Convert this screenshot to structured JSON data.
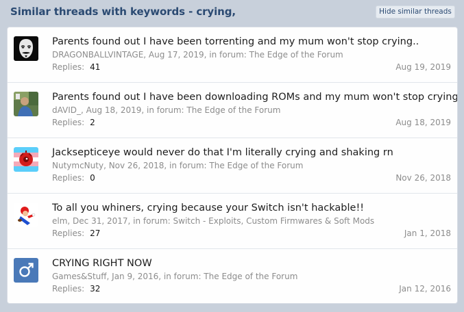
{
  "header": {
    "title": "Similar threads with keywords - crying,",
    "hide_button": "Hide similar threads"
  },
  "replies_label": "Replies:",
  "threads": [
    {
      "title": "Parents found out I have been torrenting and my mum won't stop crying..",
      "meta": "DRAGONBALLVINTAGE, Aug 17, 2019, in forum: The Edge of the Forum",
      "replies": "41",
      "last_date": "Aug 19, 2019",
      "avatar_icon": "anonymous-mask-avatar"
    },
    {
      "title": "Parents found out I have been downloading ROMs and my mum won't stop crying..",
      "meta": "dAVID_, Aug 18, 2019, in forum: The Edge of the Forum",
      "replies": "2",
      "last_date": "Aug 18, 2019",
      "avatar_icon": "photo-avatar"
    },
    {
      "title": "Jacksepticeye would never do that I'm literally crying and shaking rn",
      "meta": "NutymcNuty, Nov 26, 2018, in forum: The Edge of the Forum",
      "replies": "0",
      "last_date": "Nov 26, 2018",
      "avatar_icon": "septic-eye-avatar"
    },
    {
      "title": "To all you whiners, crying because your Switch isn't hackable!!",
      "meta": "elm, Dec 31, 2017, in forum: Switch - Exploits, Custom Firmwares & Soft Mods",
      "replies": "27",
      "last_date": "Jan 1, 2018",
      "avatar_icon": "mario-avatar"
    },
    {
      "title": "CRYING RIGHT NOW",
      "meta": "Games&Stuff, Jan 9, 2016, in forum: The Edge of the Forum",
      "replies": "32",
      "last_date": "Jan 12, 2016",
      "avatar_icon": "male-symbol-avatar"
    }
  ]
}
